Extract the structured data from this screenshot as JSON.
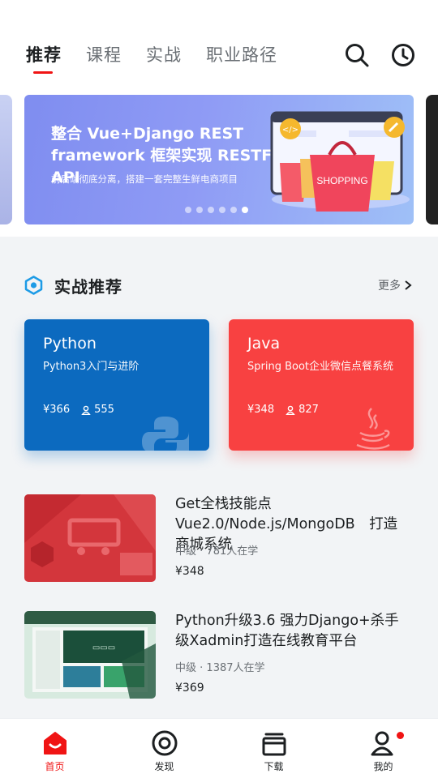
{
  "top_tabs": [
    {
      "label": "推荐",
      "active": true
    },
    {
      "label": "课程",
      "active": false
    },
    {
      "label": "实战",
      "active": false
    },
    {
      "label": "职业路径",
      "active": false
    }
  ],
  "header_icons": [
    "search-icon",
    "history-icon"
  ],
  "banner": {
    "title": "整合 Vue+Django REST framework 框架实现 RESTFul API",
    "subtitle": "前后端彻底分离，搭建一套完整生鲜电商项目",
    "art_text": "SHOPPING",
    "slides": 6,
    "active_slide": 6
  },
  "section": {
    "title": "实战推荐",
    "more": "更多",
    "accent": "#1d9be6"
  },
  "cards": [
    {
      "name": "Python",
      "desc": "Python3入门与进阶",
      "price": "¥366",
      "students": "555",
      "color": "#0c6abf",
      "icon": "python-logo-icon"
    },
    {
      "name": "Java",
      "desc": "Spring Boot企业微信点餐系统",
      "price": "¥348",
      "students": "827",
      "color": "#f84141",
      "icon": "java-logo-icon"
    }
  ],
  "courses": [
    {
      "title": "Get全栈技能点Vue2.0/Node.js/MongoDB　打造商城系统",
      "level": "中级",
      "learners": "781人在学",
      "price": "¥348"
    },
    {
      "title": "Python升级3.6 强力Django+杀手级Xadmin打造在线教育平台",
      "level": "中级",
      "learners": "1387人在学",
      "price": "¥369"
    }
  ],
  "meta_separator": " · ",
  "bottom_nav": [
    {
      "label": "首页",
      "icon": "home-icon",
      "active": true
    },
    {
      "label": "发现",
      "icon": "discover-icon",
      "active": false
    },
    {
      "label": "下载",
      "icon": "download-icon",
      "active": false
    },
    {
      "label": "我的",
      "icon": "profile-icon",
      "active": false,
      "badge": true
    }
  ],
  "colors": {
    "brand_red": "#f01414",
    "text_dark": "#1c1f21",
    "text_gray": "#6b7075"
  }
}
